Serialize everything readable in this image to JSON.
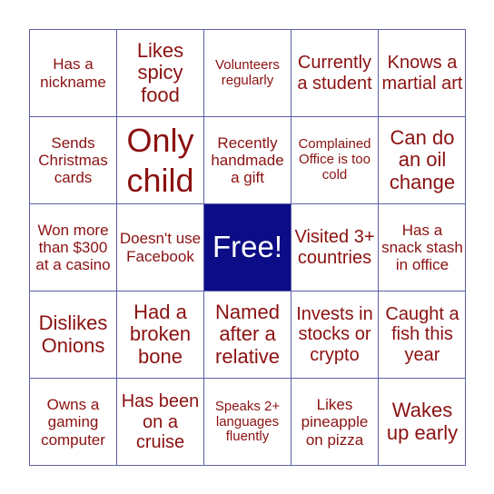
{
  "board": {
    "colors": {
      "text": "#8b1111",
      "grid": "#5b5fa8",
      "free_bg": "#0c0c86",
      "free_text": "#ffffff"
    },
    "cells": [
      {
        "text": "Has a nickname",
        "size": "s-s"
      },
      {
        "text": "Likes spicy food",
        "size": "s-l"
      },
      {
        "text": "Volunteers regularly",
        "size": "s-xs"
      },
      {
        "text": "Currently a student",
        "size": "s-m"
      },
      {
        "text": "Knows a martial art",
        "size": "s-m"
      },
      {
        "text": "Sends Christmas cards",
        "size": "s-s"
      },
      {
        "text": "Only child",
        "size": "s-xl"
      },
      {
        "text": "Recently handmade a gift",
        "size": "s-s"
      },
      {
        "text": "Complained Office is too cold",
        "size": "s-xs"
      },
      {
        "text": "Can do an oil change",
        "size": "s-l"
      },
      {
        "text": "Won more than $300 at a casino",
        "size": "s-s"
      },
      {
        "text": "Doesn't use Facebook",
        "size": "s-s"
      },
      {
        "text": "Free!",
        "size": "s-free",
        "free": true
      },
      {
        "text": "Visited 3+ countries",
        "size": "s-m"
      },
      {
        "text": "Has a snack stash in office",
        "size": "s-s"
      },
      {
        "text": "Dislikes Onions",
        "size": "s-l"
      },
      {
        "text": "Had a broken bone",
        "size": "s-l"
      },
      {
        "text": "Named after a relative",
        "size": "s-l"
      },
      {
        "text": "Invests in stocks or crypto",
        "size": "s-m"
      },
      {
        "text": "Caught a fish this year",
        "size": "s-m"
      },
      {
        "text": "Owns a gaming computer",
        "size": "s-s"
      },
      {
        "text": "Has been on a cruise",
        "size": "s-m"
      },
      {
        "text": "Speaks 2+ languages fluently",
        "size": "s-xs"
      },
      {
        "text": "Likes pineapple on pizza",
        "size": "s-s"
      },
      {
        "text": "Wakes up early",
        "size": "s-l"
      }
    ]
  }
}
